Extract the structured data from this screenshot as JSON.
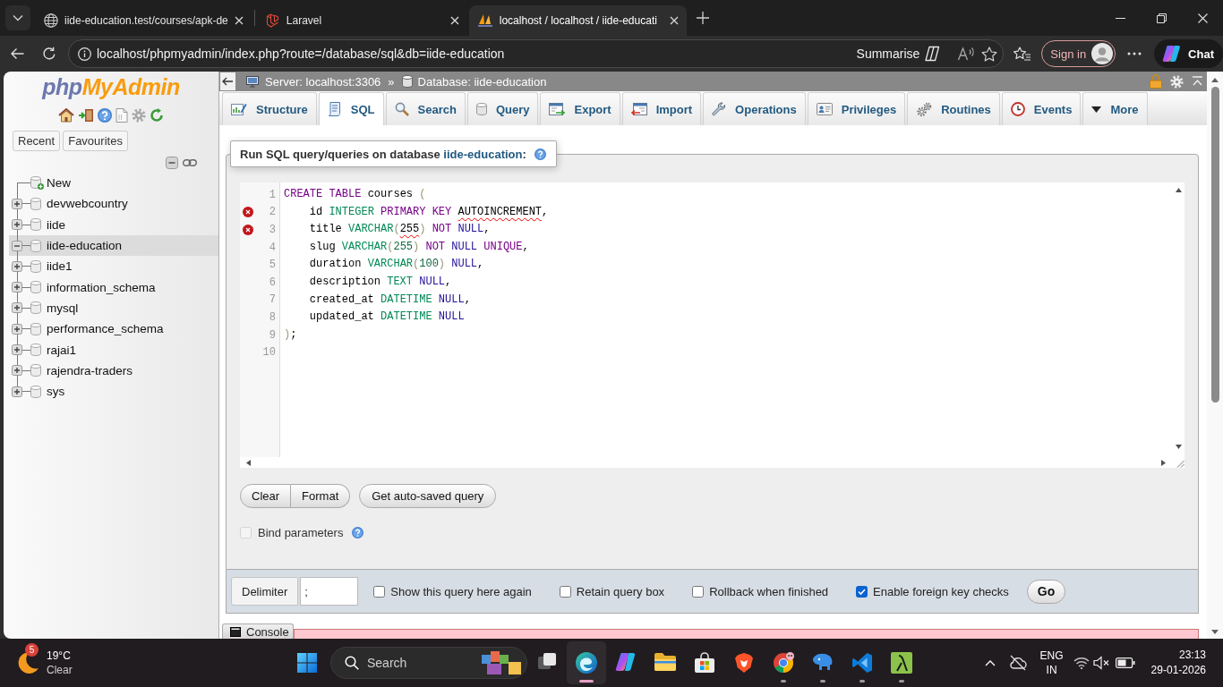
{
  "browser": {
    "tabs": [
      {
        "title": "iide-education.test/courses/apk-de",
        "selected": false
      },
      {
        "title": "Laravel",
        "selected": false
      },
      {
        "title": "localhost / localhost / iide-educati",
        "selected": true
      }
    ],
    "address": "localhost/phpmyadmin/index.php?route=/database/sql&db=iide-education",
    "summarise": "Summarise",
    "sign_in": "Sign in",
    "chat": "Chat"
  },
  "sidebar": {
    "logo": [
      "php",
      "MyAdmin"
    ],
    "buttons": [
      "Recent",
      "Favourites"
    ],
    "tree": [
      {
        "kind": "new",
        "label": "New",
        "selected": false
      },
      {
        "kind": "database",
        "label": "devwebcountry",
        "expanded": false,
        "selected": false
      },
      {
        "kind": "database",
        "label": "iide",
        "expanded": false,
        "selected": false
      },
      {
        "kind": "database",
        "label": "iide-education",
        "expanded": true,
        "selected": true
      },
      {
        "kind": "database",
        "label": "iide1",
        "expanded": false,
        "selected": false
      },
      {
        "kind": "database",
        "label": "information_schema",
        "expanded": false,
        "selected": false
      },
      {
        "kind": "database",
        "label": "mysql",
        "expanded": false,
        "selected": false
      },
      {
        "kind": "database",
        "label": "performance_schema",
        "expanded": false,
        "selected": false
      },
      {
        "kind": "database",
        "label": "rajai1",
        "expanded": false,
        "selected": false
      },
      {
        "kind": "database",
        "label": "rajendra-traders",
        "expanded": false,
        "selected": false
      },
      {
        "kind": "database",
        "label": "sys",
        "expanded": false,
        "selected": false
      }
    ]
  },
  "main": {
    "breadcrumb": {
      "server": "Server: localhost:3306",
      "separator": "»",
      "database": "Database: iide-education"
    },
    "tabs": [
      {
        "label": "Structure",
        "selected": false
      },
      {
        "label": "SQL",
        "selected": true
      },
      {
        "label": "Search",
        "selected": false
      },
      {
        "label": "Query",
        "selected": false
      },
      {
        "label": "Export",
        "selected": false
      },
      {
        "label": "Import",
        "selected": false
      },
      {
        "label": "Operations",
        "selected": false
      },
      {
        "label": "Privileges",
        "selected": false
      },
      {
        "label": "Routines",
        "selected": false
      },
      {
        "label": "Events",
        "selected": false
      },
      {
        "label": "More",
        "selected": false
      }
    ],
    "sql_panel": {
      "legend": {
        "text": "Run SQL query/queries on database",
        "database": "iide-education",
        "suffix": ":"
      },
      "editor": {
        "lines": [
          {
            "number": "1",
            "error": false,
            "tokens": [
              {
                "text": "CREATE ",
                "kind": "keyword"
              },
              {
                "text": "TABLE",
                "kind": "keyword"
              },
              {
                "text": " courses ",
                "kind": "plain"
              },
              {
                "text": "(",
                "kind": "bracket"
              }
            ]
          },
          {
            "number": "2",
            "error": true,
            "tokens": [
              {
                "text": "    id ",
                "kind": "plain"
              },
              {
                "text": "INTEGER ",
                "kind": "type"
              },
              {
                "text": "PRIMARY ",
                "kind": "keyword"
              },
              {
                "text": "KEY ",
                "kind": "keyword"
              },
              {
                "text": "AUTOINCREMENT",
                "kind": "error"
              },
              {
                "text": ",",
                "kind": "plain"
              }
            ]
          },
          {
            "number": "3",
            "error": true,
            "tokens": [
              {
                "text": "    title ",
                "kind": "plain"
              },
              {
                "text": "VARCHAR",
                "kind": "type"
              },
              {
                "text": "(",
                "kind": "bracket"
              },
              {
                "text": "255",
                "kind": "error"
              },
              {
                "text": ") ",
                "kind": "bracket"
              },
              {
                "text": "NOT ",
                "kind": "keyword"
              },
              {
                "text": "NULL",
                "kind": "atom"
              },
              {
                "text": ",",
                "kind": "plain"
              }
            ]
          },
          {
            "number": "4",
            "error": false,
            "tokens": [
              {
                "text": "    slug ",
                "kind": "plain"
              },
              {
                "text": "VARCHAR",
                "kind": "type"
              },
              {
                "text": "(",
                "kind": "bracket"
              },
              {
                "text": "255",
                "kind": "number"
              },
              {
                "text": ") ",
                "kind": "bracket"
              },
              {
                "text": "NOT ",
                "kind": "keyword"
              },
              {
                "text": "NULL ",
                "kind": "atom"
              },
              {
                "text": "UNIQUE",
                "kind": "keyword"
              },
              {
                "text": ",",
                "kind": "plain"
              }
            ]
          },
          {
            "number": "5",
            "error": false,
            "tokens": [
              {
                "text": "    duration ",
                "kind": "plain"
              },
              {
                "text": "VARCHAR",
                "kind": "type"
              },
              {
                "text": "(",
                "kind": "bracket"
              },
              {
                "text": "100",
                "kind": "number"
              },
              {
                "text": ") ",
                "kind": "bracket"
              },
              {
                "text": "NULL",
                "kind": "atom"
              },
              {
                "text": ",",
                "kind": "plain"
              }
            ]
          },
          {
            "number": "6",
            "error": false,
            "tokens": [
              {
                "text": "    description ",
                "kind": "plain"
              },
              {
                "text": "TEXT ",
                "kind": "type"
              },
              {
                "text": "NULL",
                "kind": "atom"
              },
              {
                "text": ",",
                "kind": "plain"
              }
            ]
          },
          {
            "number": "7",
            "error": false,
            "tokens": [
              {
                "text": "    created_at ",
                "kind": "plain"
              },
              {
                "text": "DATETIME ",
                "kind": "type"
              },
              {
                "text": "NULL",
                "kind": "atom"
              },
              {
                "text": ",",
                "kind": "plain"
              }
            ]
          },
          {
            "number": "8",
            "error": false,
            "tokens": [
              {
                "text": "    updated_at ",
                "kind": "plain"
              },
              {
                "text": "DATETIME ",
                "kind": "type"
              },
              {
                "text": "NULL",
                "kind": "atom"
              }
            ]
          },
          {
            "number": "9",
            "error": false,
            "tokens": [
              {
                "text": ")",
                "kind": "bracket"
              },
              {
                "text": ";",
                "kind": "plain"
              }
            ]
          },
          {
            "number": "10",
            "error": false
          }
        ]
      },
      "buttons": [
        "Clear",
        "Format",
        "Get auto-saved query"
      ],
      "bind_parameters": {
        "label": "Bind parameters",
        "checked": false,
        "disabled": true
      }
    },
    "options_bar": {
      "delimiter_label": "Delimiter",
      "delimiter": ";",
      "options": [
        {
          "label": "Show this query here again",
          "checked": false
        },
        {
          "label": "Retain query box",
          "checked": false
        },
        {
          "label": "Rollback when finished",
          "checked": false
        },
        {
          "label": "Enable foreign key checks",
          "checked": true
        }
      ],
      "go": "Go"
    },
    "console": {
      "label": "Console"
    }
  },
  "taskbar": {
    "weather": {
      "badge": "5",
      "temperature": "19°C",
      "condition": "Clear"
    },
    "search": {
      "placeholder": "Search"
    },
    "apps": [
      {
        "running": false,
        "selected": false
      },
      {
        "running": true,
        "selected": true
      },
      {
        "running": false,
        "selected": false
      },
      {
        "running": false,
        "selected": false
      },
      {
        "running": false,
        "selected": false
      },
      {
        "running": false,
        "selected": false
      },
      {
        "running": true,
        "selected": false
      },
      {
        "running": true,
        "selected": false
      },
      {
        "running": true,
        "selected": false
      },
      {
        "running": true,
        "selected": false
      }
    ],
    "language": "ENG",
    "region": "IN",
    "time": "23:13",
    "date": "29-01-2026"
  }
}
